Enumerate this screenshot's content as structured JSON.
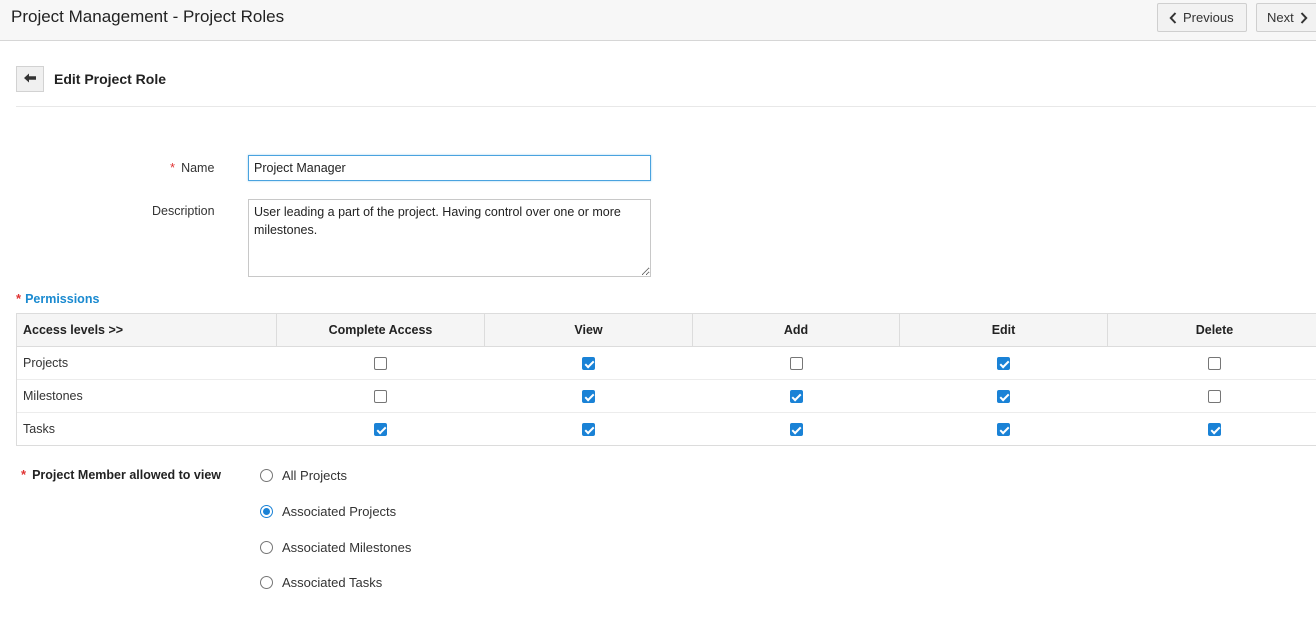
{
  "header": {
    "title": "Project Management - Project Roles",
    "previous_label": "Previous",
    "next_label": "Next"
  },
  "section": {
    "title": "Edit Project Role"
  },
  "form": {
    "name_label": "Name",
    "name_value": "Project Manager",
    "description_label": "Description",
    "description_value": "User leading a part of the project. Having control over one or more milestones."
  },
  "permissions": {
    "label": "Permissions",
    "columns": [
      "Access levels >>",
      "Complete Access",
      "View",
      "Add",
      "Edit",
      "Delete"
    ],
    "rows": [
      {
        "name": "Projects",
        "values": [
          false,
          true,
          false,
          true,
          false
        ]
      },
      {
        "name": "Milestones",
        "values": [
          false,
          true,
          true,
          true,
          false
        ]
      },
      {
        "name": "Tasks",
        "values": [
          true,
          true,
          true,
          true,
          true
        ]
      }
    ]
  },
  "member_view": {
    "label": "Project Member allowed to view",
    "options": [
      {
        "label": "All Projects",
        "selected": false
      },
      {
        "label": "Associated Projects",
        "selected": true
      },
      {
        "label": "Associated Milestones",
        "selected": false
      },
      {
        "label": "Associated Tasks",
        "selected": false
      }
    ]
  },
  "colors": {
    "accent": "#1a82d6",
    "required": "#e03333",
    "permissions_label": "#1a8ad0"
  }
}
